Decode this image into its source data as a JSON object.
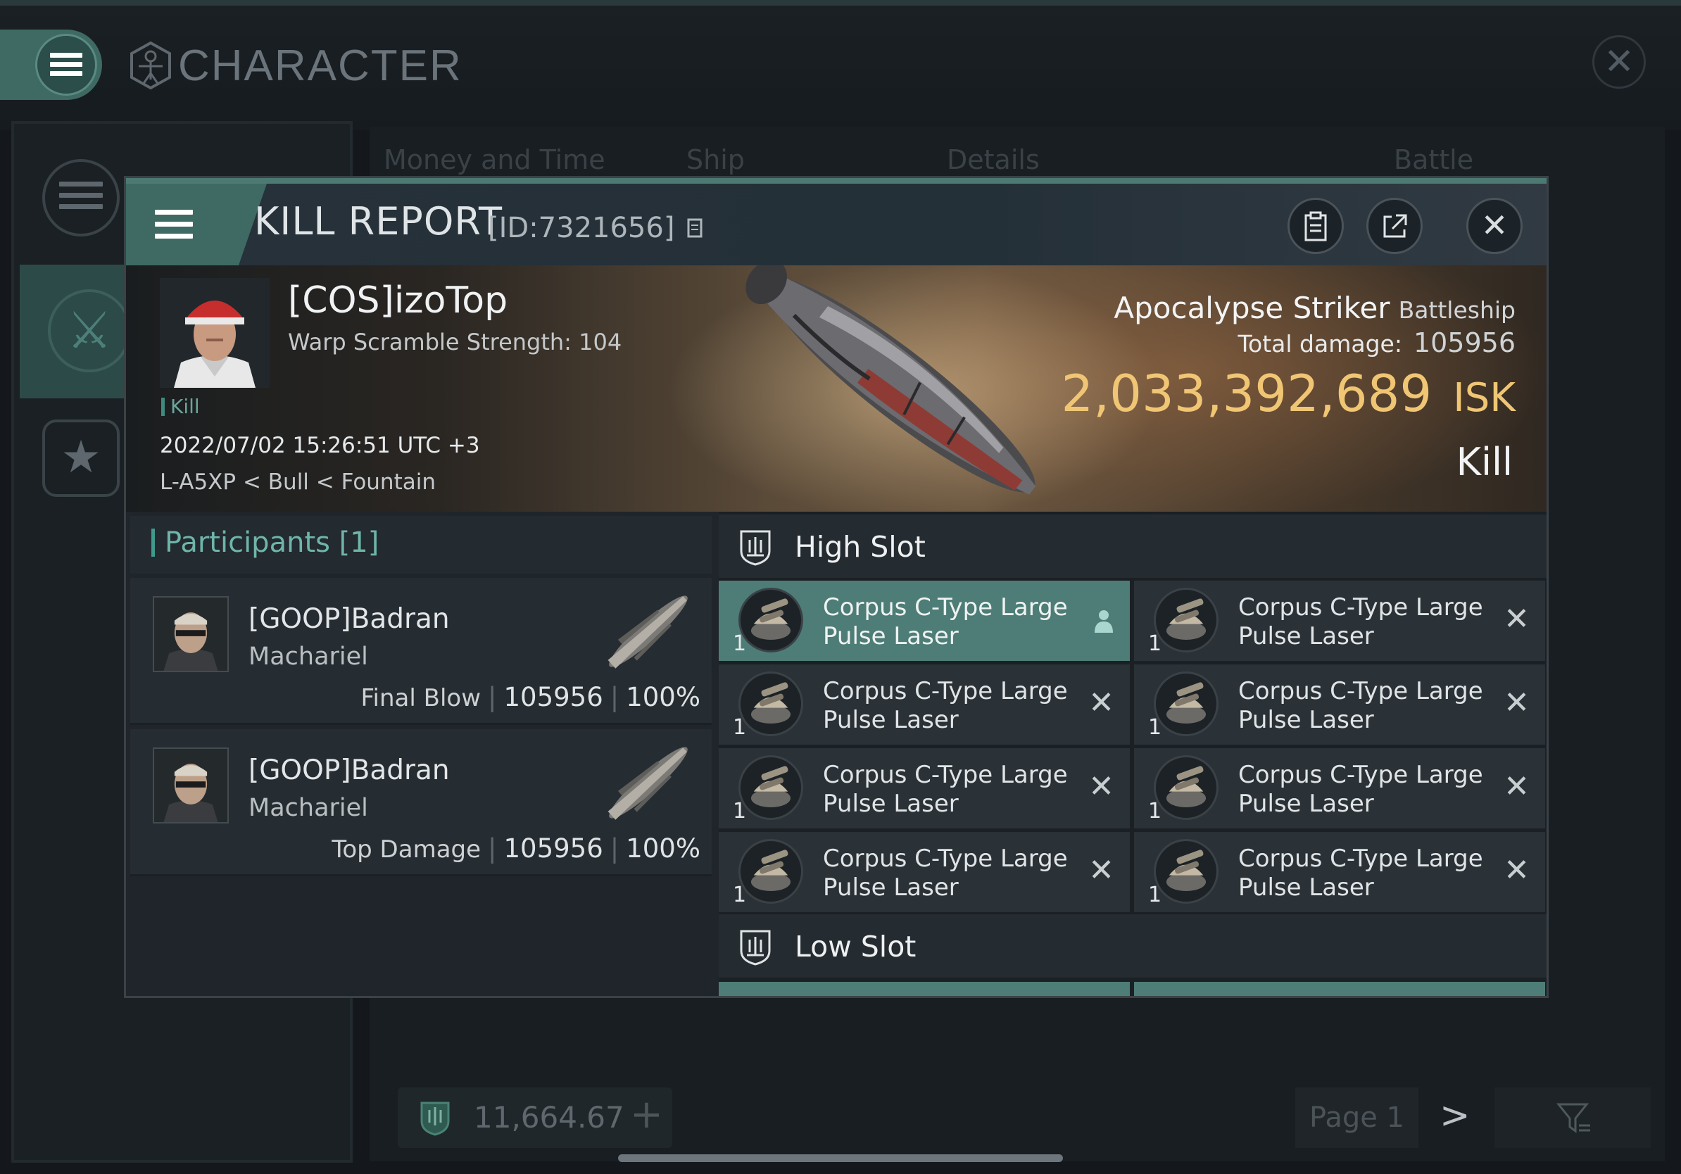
{
  "app": {
    "title": "CHARACTER"
  },
  "background": {
    "tabs": [
      "Money and Time",
      "Ship",
      "Details",
      "Battle Status"
    ],
    "wallet_value": "11,664.67",
    "page_label": "Page 1",
    "next_symbol": ">"
  },
  "kill_report": {
    "title": "KILL REPORT",
    "id": "[ID:7321656]",
    "victim": {
      "name": "[COS]izoTop",
      "warp_scramble": "Warp Scramble Strength: 104",
      "tag": "Kill",
      "time": "2022/07/02 15:26:51 UTC +3",
      "location": "L-A5XP < Bull < Fountain"
    },
    "ship": {
      "name": "Apocalypse Striker",
      "class": "Battleship",
      "damage_label": "Total damage:",
      "damage_value": "105956",
      "isk_value": "2,033,392,689",
      "isk_unit": "ISK",
      "status": "Kill"
    },
    "participants": {
      "title": "Participants [1]",
      "rows": [
        {
          "name": "[GOOP]Badran",
          "ship": "Machariel",
          "role": "Final Blow",
          "damage": "105956",
          "percent": "100%"
        },
        {
          "name": "[GOOP]Badran",
          "ship": "Machariel",
          "role": "Top Damage",
          "damage": "105956",
          "percent": "100%"
        }
      ]
    },
    "high_slot": {
      "title": "High Slot",
      "modules": [
        {
          "name": "Corpus C-Type Large Pulse Laser",
          "qty": "1",
          "state": "fitted"
        },
        {
          "name": "Corpus C-Type Large Pulse Laser",
          "qty": "1",
          "state": "destroyed"
        },
        {
          "name": "Corpus C-Type Large Pulse Laser",
          "qty": "1",
          "state": "destroyed"
        },
        {
          "name": "Corpus C-Type Large Pulse Laser",
          "qty": "1",
          "state": "destroyed"
        },
        {
          "name": "Corpus C-Type Large Pulse Laser",
          "qty": "1",
          "state": "destroyed"
        },
        {
          "name": "Corpus C-Type Large Pulse Laser",
          "qty": "1",
          "state": "destroyed"
        },
        {
          "name": "Corpus C-Type Large Pulse Laser",
          "qty": "1",
          "state": "destroyed"
        },
        {
          "name": "Corpus C-Type Large Pulse Laser",
          "qty": "1",
          "state": "destroyed"
        }
      ]
    },
    "low_slot": {
      "title": "Low Slot"
    }
  },
  "icons": {
    "menu": "hamburger-icon",
    "character": "vitruvian-icon",
    "close": "close-icon",
    "copy": "copy-icon",
    "clipboard": "clipboard-icon",
    "share": "share-icon",
    "slot": "slot-shield-icon",
    "dropped": "person-icon",
    "destroyed": "x-icon"
  },
  "colors": {
    "accent": "#3e6a63",
    "isk": "#f0c674",
    "participants": "#6fb5a9"
  }
}
